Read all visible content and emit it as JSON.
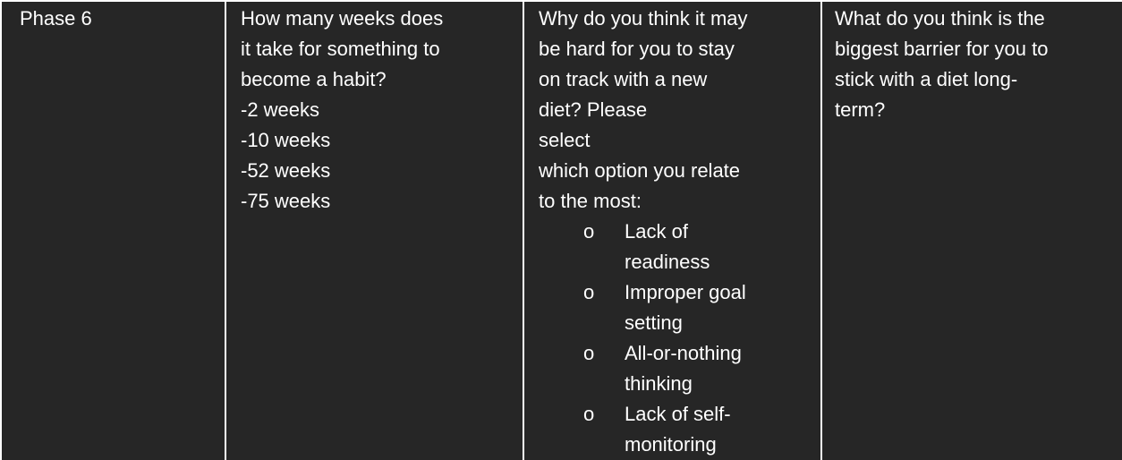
{
  "table": {
    "phase_label": "Phase 6",
    "q1": {
      "question": [
        "How many weeks does",
        "it take for something to",
        "become a habit?"
      ],
      "answers": [
        "-2 weeks",
        "-10 weeks",
        "-52 weeks",
        "-75 weeks"
      ]
    },
    "q2": {
      "question": [
        "Why do you think it may",
        "be hard for you to stay",
        "on track with a new",
        "diet? Please",
        "select",
        "which option you relate",
        "to the most:"
      ],
      "bullet": "o",
      "options": [
        [
          "Lack of",
          "readiness"
        ],
        [
          "Improper goal",
          "setting"
        ],
        [
          "All-or-nothing",
          "thinking"
        ],
        [
          "Lack of self-",
          "monitoring"
        ]
      ]
    },
    "q3": {
      "question": [
        "What do you think is the",
        "biggest barrier for you to",
        "stick with a diet long-",
        "term?"
      ]
    }
  }
}
